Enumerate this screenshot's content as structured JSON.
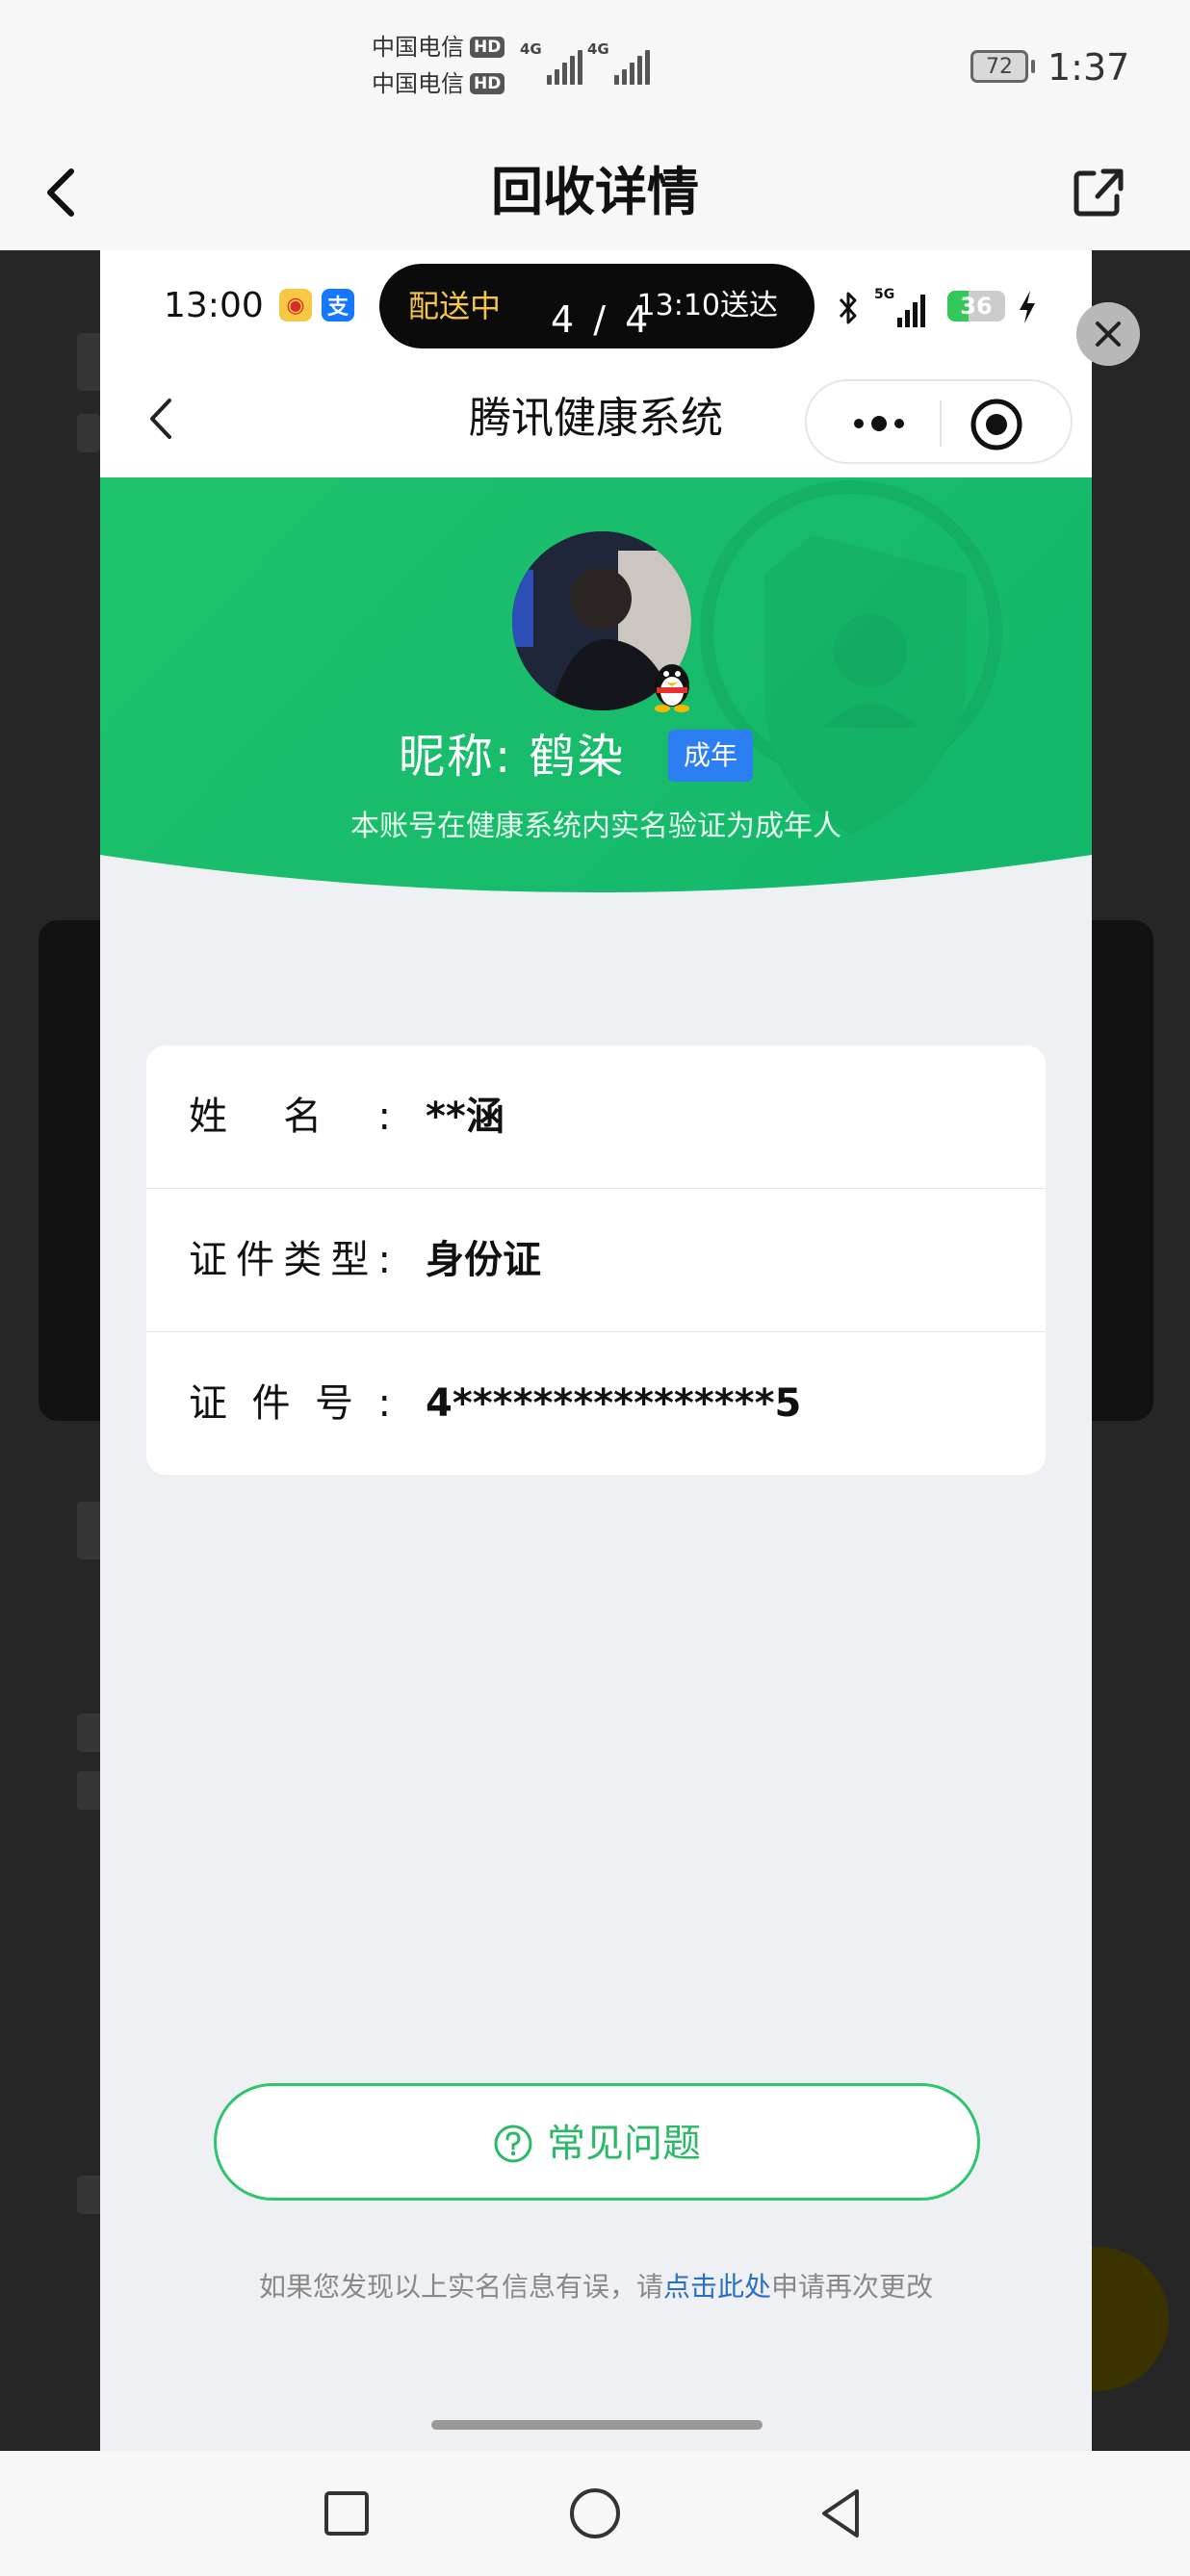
{
  "outer_status": {
    "carrier_1": "中国电信",
    "carrier_2": "中国电信",
    "hd_badge": "HD",
    "network_label": "4G",
    "battery_level": "72",
    "time": "1:37"
  },
  "outer_nav": {
    "title": "回收详情",
    "back_icon": "chevron-left-icon",
    "share_icon": "share-icon"
  },
  "inner_status": {
    "time": "13:00",
    "delivery_status": "配送中",
    "delivery_eta": "13:10送达",
    "page_indicator": "4 / 4",
    "network_label": "5G",
    "battery_level": "36"
  },
  "mini_program": {
    "title": "腾讯健康系统",
    "back_icon": "chevron-left-icon",
    "more_icon": "more-dots-icon",
    "close_icon": "target-circle-icon"
  },
  "profile": {
    "nickname": "昵称:  鹤染",
    "age_tag": "成年",
    "verification_note": "本账号在健康系统内实名验证为成年人"
  },
  "identity_info": [
    {
      "label": "姓名:",
      "value": "**涵"
    },
    {
      "label": "证件类型:",
      "value": "身份证"
    },
    {
      "label": "证件号:",
      "value": "4****************5"
    }
  ],
  "faq": {
    "label": "常见问题",
    "icon": "question-circle-icon"
  },
  "footer": {
    "note_prefix": "如果您发现以上实名信息有误，请",
    "link_text": "点击此处",
    "note_suffix": "申请再次更改"
  },
  "colors": {
    "brand_green": "#2bb968",
    "tag_blue": "#2c7ff3",
    "link_blue": "#2b6fbf"
  }
}
